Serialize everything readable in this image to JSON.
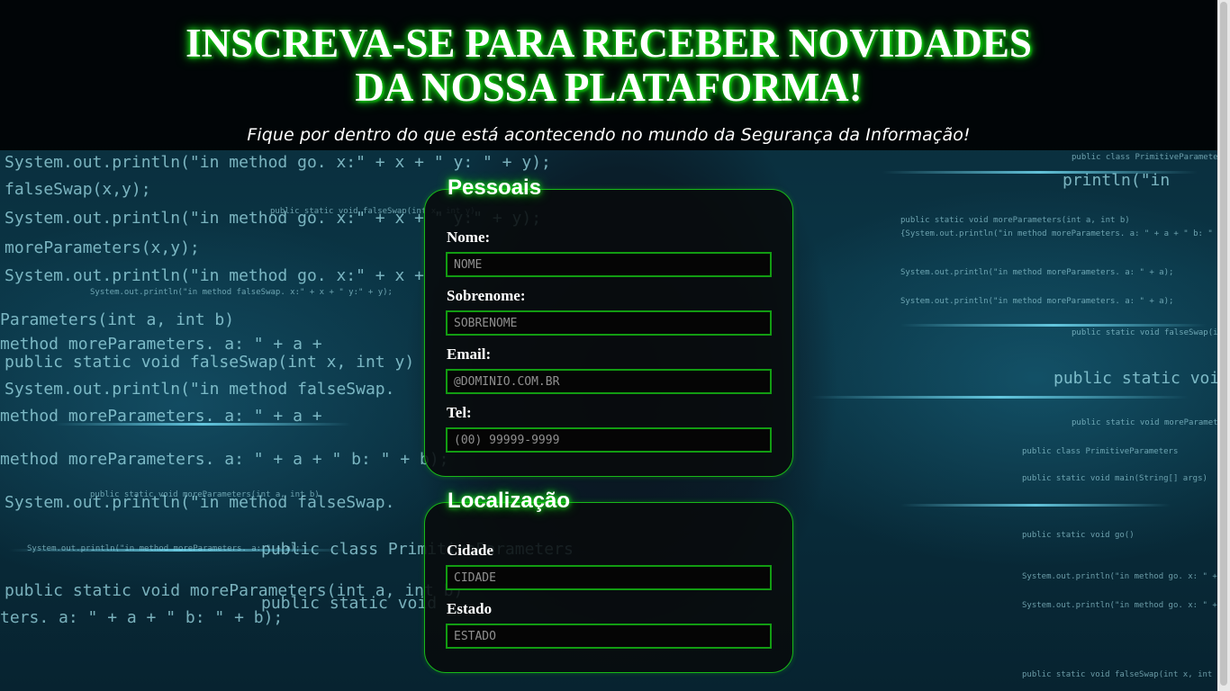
{
  "header": {
    "title_line1": "INSCREVA-SE PARA RECEBER NOVIDADES",
    "title_line2": "DA NOSSA PLATAFORMA!",
    "subtitle": "Fique por dentro do que está acontecendo no mundo da Segurança da Informação!"
  },
  "pessoais": {
    "legend": "Pessoais",
    "nome_label": "Nome:",
    "nome_placeholder": "NOME",
    "sobrenome_label": "Sobrenome:",
    "sobrenome_placeholder": "SOBRENOME",
    "email_label": "Email:",
    "email_placeholder": "@DOMINIO.COM.BR",
    "tel_label": "Tel:",
    "tel_placeholder": "(00) 99999-9999"
  },
  "localizacao": {
    "legend": "Localização",
    "cidade_label": "Cidade",
    "cidade_placeholder": "CIDADE",
    "estado_label": "Estado",
    "estado_placeholder": "ESTADO"
  },
  "colors": {
    "accent_green": "#18b818",
    "glow_green": "#19ff19",
    "panel_bg": "#080a0c",
    "header_bg": "#000000"
  }
}
